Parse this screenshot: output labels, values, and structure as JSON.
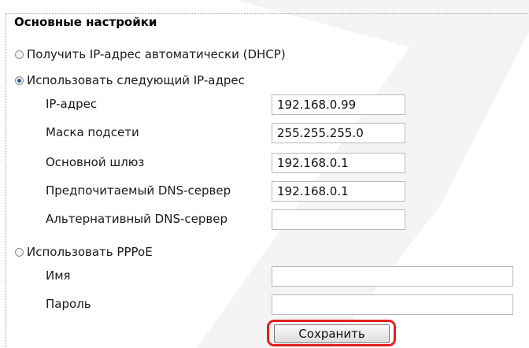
{
  "section_title": "Основные настройки",
  "dhcp_option": {
    "label": "Получить IP-адрес автоматически (DHCP)",
    "checked": false
  },
  "static_option": {
    "label": "Использовать следующий IP-адрес",
    "checked": true
  },
  "static_fields": [
    {
      "label": "IP-адрес",
      "value": "192.168.0.99"
    },
    {
      "label": "Маска подсети",
      "value": "255.255.255.0"
    },
    {
      "label": "Основной шлюз",
      "value": "192.168.0.1"
    },
    {
      "label": "Предпочитаемый DNS-сервер",
      "value": "192.168.0.1"
    },
    {
      "label": "Альтернативный DNS-сервер",
      "value": ""
    }
  ],
  "pppoe_option": {
    "label": "Использовать PPPoE",
    "checked": false
  },
  "pppoe_fields": [
    {
      "label": "Имя",
      "value": ""
    },
    {
      "label": "Пароль",
      "value": ""
    }
  ],
  "save_label": "Сохранить",
  "colors": {
    "highlight": "#e22020",
    "radio_selected": "#2b5aa6"
  }
}
